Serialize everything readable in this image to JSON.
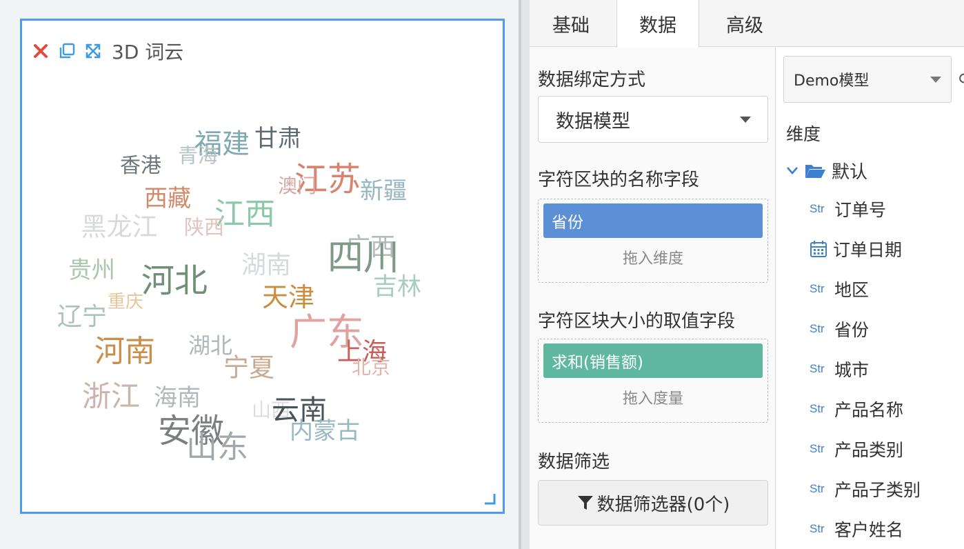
{
  "widget": {
    "title": "3D 词云",
    "toolbar_icons": [
      "close-icon",
      "copy-icon",
      "fullscreen-icon"
    ],
    "words": [
      {
        "text": "福建",
        "color": "#7fa9b0",
        "size": 40
      },
      {
        "text": "甘肃",
        "color": "#5f6b73",
        "size": 34
      },
      {
        "text": "青海",
        "color": "#b9c3c6",
        "size": 29
      },
      {
        "text": "香港",
        "color": "#6f767b",
        "size": 30
      },
      {
        "text": "江苏",
        "color": "#d9836f",
        "size": 48
      },
      {
        "text": "澳门",
        "color": "#d9a5a0",
        "size": 28
      },
      {
        "text": "新疆",
        "color": "#94b6c0",
        "size": 34
      },
      {
        "text": "西藏",
        "color": "#d08a6c",
        "size": 34
      },
      {
        "text": "江西",
        "color": "#8cc9a9",
        "size": 44
      },
      {
        "text": "黑龙江",
        "color": "#d8d9db",
        "size": 37
      },
      {
        "text": "陕西",
        "color": "#e2c3c0",
        "size": 29
      },
      {
        "text": "广西",
        "color": "#b6babd",
        "size": 36
      },
      {
        "text": "四川",
        "color": "#7e9a86",
        "size": 52
      },
      {
        "text": "湖南",
        "color": "#d7dadc",
        "size": 36
      },
      {
        "text": "贵州",
        "color": "#a9c8a8",
        "size": 34
      },
      {
        "text": "河北",
        "color": "#6f8f77",
        "size": 48
      },
      {
        "text": "吉林",
        "color": "#a7cdbd",
        "size": 35
      },
      {
        "text": "重庆",
        "color": "#e8c59a",
        "size": 26
      },
      {
        "text": "天津",
        "color": "#c98d3c",
        "size": 38
      },
      {
        "text": "辽宁",
        "color": "#a9c5b5",
        "size": 36
      },
      {
        "text": "广东",
        "color": "#e0a3a0",
        "size": 54
      },
      {
        "text": "河南",
        "color": "#c98f4a",
        "size": 44
      },
      {
        "text": "湖北",
        "color": "#b1b6ba",
        "size": 32
      },
      {
        "text": "上海",
        "color": "#c85d55",
        "size": 36
      },
      {
        "text": "北京",
        "color": "#e5b3ad",
        "size": 28
      },
      {
        "text": "宁夏",
        "color": "#c7aa8f",
        "size": 37
      },
      {
        "text": "浙江",
        "color": "#ccb3ac",
        "size": 42
      },
      {
        "text": "海南",
        "color": "#b3b7bb",
        "size": 34
      },
      {
        "text": "山西",
        "color": "#dcdcdc",
        "size": 28
      },
      {
        "text": "云南",
        "color": "#4a5259",
        "size": 40
      },
      {
        "text": "安徽",
        "color": "#7c7f82",
        "size": 48
      },
      {
        "text": "内蒙古",
        "color": "#98b9c1",
        "size": 34
      },
      {
        "text": "山东",
        "color": "#a1a8ad",
        "size": 45
      }
    ]
  },
  "tabs": [
    {
      "label": "基础",
      "active": false
    },
    {
      "label": "数据",
      "active": true
    },
    {
      "label": "高级",
      "active": false
    }
  ],
  "config": {
    "binding_label": "数据绑定方式",
    "binding_value": "数据模型",
    "name_field_label": "字符区块的名称字段",
    "name_field_chip": "省份",
    "name_field_hint": "拖入维度",
    "size_field_label": "字符区块大小的取值字段",
    "size_field_chip": "求和(销售额)",
    "size_field_hint": "拖入度量",
    "filter_label": "数据筛选",
    "filter_button": "数据筛选器(0个)",
    "colors": {
      "dimension_chip": "#5b8fd6",
      "measure_chip": "#5fb7a0",
      "accent": "#4c9bf0"
    }
  },
  "fields": {
    "model": "Demo模型",
    "dimension_label": "维度",
    "folder": "默认",
    "items": [
      {
        "type": "Str",
        "name": "订单号"
      },
      {
        "type": "date",
        "name": "订单日期"
      },
      {
        "type": "Str",
        "name": "地区"
      },
      {
        "type": "Str",
        "name": "省份"
      },
      {
        "type": "Str",
        "name": "城市"
      },
      {
        "type": "Str",
        "name": "产品名称"
      },
      {
        "type": "Str",
        "name": "产品类别"
      },
      {
        "type": "Str",
        "name": "产品子类别"
      },
      {
        "type": "Str",
        "name": "客户姓名"
      }
    ]
  }
}
